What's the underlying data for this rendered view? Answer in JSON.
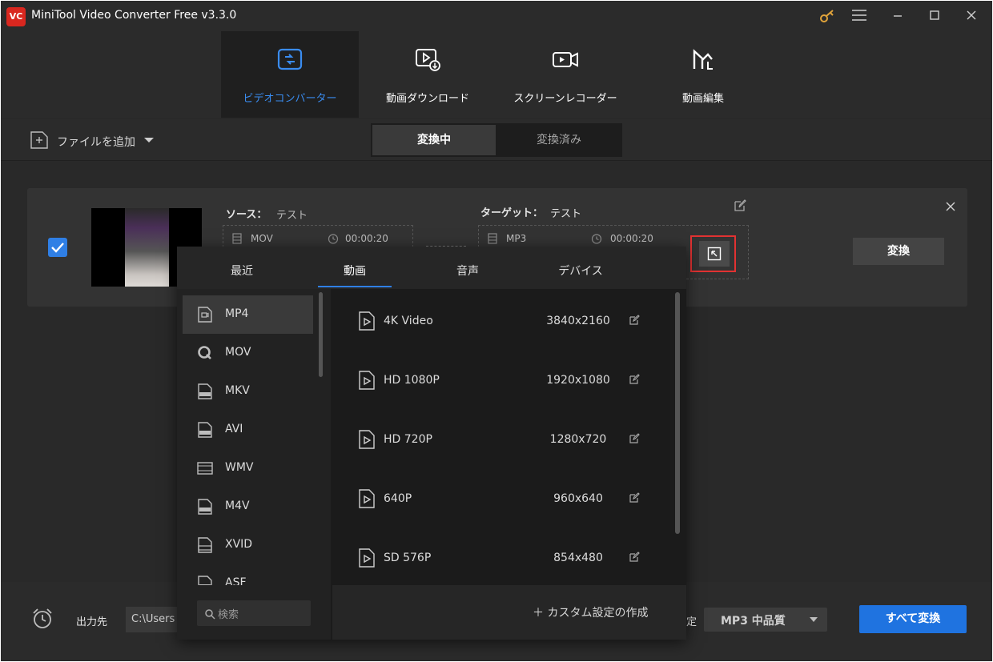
{
  "window": {
    "title": "MiniTool Video Converter Free v3.3.0",
    "logo_text": "VC"
  },
  "nav": {
    "tabs": [
      {
        "label": "ビデオコンバーター",
        "icon": "convert-icon"
      },
      {
        "label": "動画ダウンロード",
        "icon": "video-download-icon"
      },
      {
        "label": "スクリーンレコーダー",
        "icon": "screen-recorder-icon"
      },
      {
        "label": "動画編集",
        "icon": "video-edit-icon"
      }
    ],
    "active_tab": "ビデオコンバーター"
  },
  "toolbar": {
    "add_file_label": "ファイルを追加",
    "segment": {
      "converting": "変換中",
      "converted": "変換済み"
    }
  },
  "file_card": {
    "source_label": "ソース：",
    "source_name": "テスト",
    "source_format": "MOV",
    "source_duration": "00:00:20",
    "target_label": "ターゲット：",
    "target_name": "テスト",
    "target_format": "MP3",
    "target_duration": "00:00:20",
    "convert_button": "変換",
    "checked": true
  },
  "popup": {
    "tabs": [
      "最近",
      "動画",
      "音声",
      "デバイス"
    ],
    "active_tab": "動画",
    "formats": [
      "MP4",
      "MOV",
      "MKV",
      "AVI",
      "WMV",
      "M4V",
      "XVID",
      "ASF"
    ],
    "selected_format": "MP4",
    "search_placeholder": "検索",
    "presets": [
      {
        "name": "4K Video",
        "resolution": "3840x2160"
      },
      {
        "name": "HD 1080P",
        "resolution": "1920x1080"
      },
      {
        "name": "HD 720P",
        "resolution": "1280x720"
      },
      {
        "name": "640P",
        "resolution": "960x640"
      },
      {
        "name": "SD 576P",
        "resolution": "854x480"
      }
    ],
    "custom_button": "＋ カスタム設定の作成"
  },
  "bottom": {
    "output_label": "出力先",
    "output_path": "C:\\Users",
    "preset_label_fragment": "定",
    "preset_value": "MP3 中品質",
    "convert_all_button": "すべて変換"
  },
  "colors": {
    "accent": "#2f7fe5",
    "highlight_box": "#e23232",
    "logo": "#d9271f",
    "key_icon": "#e0a33a"
  }
}
